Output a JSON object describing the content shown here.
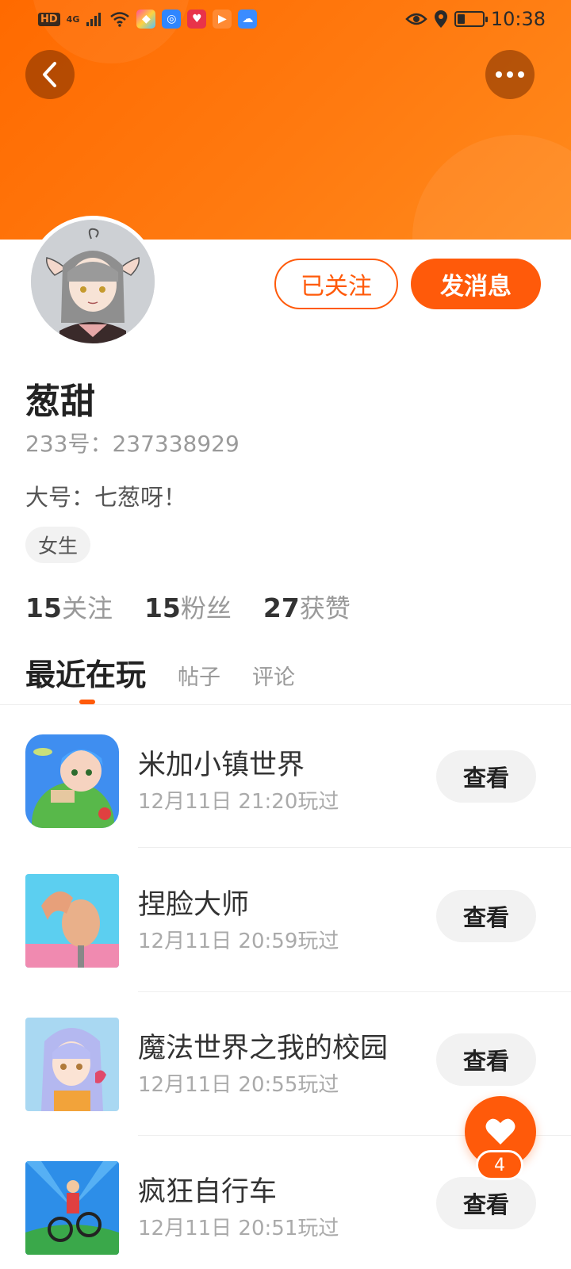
{
  "status_bar": {
    "hd": "HD",
    "network": "4G",
    "time": "10:38",
    "battery_level": 0.3
  },
  "header": {
    "back_icon": "chevron-left-icon",
    "more_icon": "more-horizontal-icon"
  },
  "profile": {
    "username": "葱甜",
    "account_id": "233号：237338929",
    "bio": "大号：七葱呀！",
    "gender_tag": "女生",
    "follow_button": "已关注",
    "message_button": "发消息",
    "stats": [
      {
        "num": "15",
        "label": "关注"
      },
      {
        "num": "15",
        "label": "粉丝"
      },
      {
        "num": "27",
        "label": "获赞"
      }
    ]
  },
  "tabs": [
    {
      "label": "最近在玩",
      "active": true
    },
    {
      "label": "帖子",
      "active": false
    },
    {
      "label": "评论",
      "active": false
    }
  ],
  "games": [
    {
      "name": "米加小镇世界",
      "time": "12月11日 21:20玩过",
      "button": "查看"
    },
    {
      "name": "捏脸大师",
      "time": "12月11日 20:59玩过",
      "button": "查看"
    },
    {
      "name": "魔法世界之我的校园",
      "time": "12月11日 20:55玩过",
      "button": "查看"
    },
    {
      "name": "疯狂自行车",
      "time": "12月11日 20:51玩过",
      "button": "查看"
    }
  ],
  "fab": {
    "icon": "heart-icon",
    "badge": "4"
  },
  "colors": {
    "accent": "#ff5a0a",
    "banner": "#ff7a10"
  }
}
